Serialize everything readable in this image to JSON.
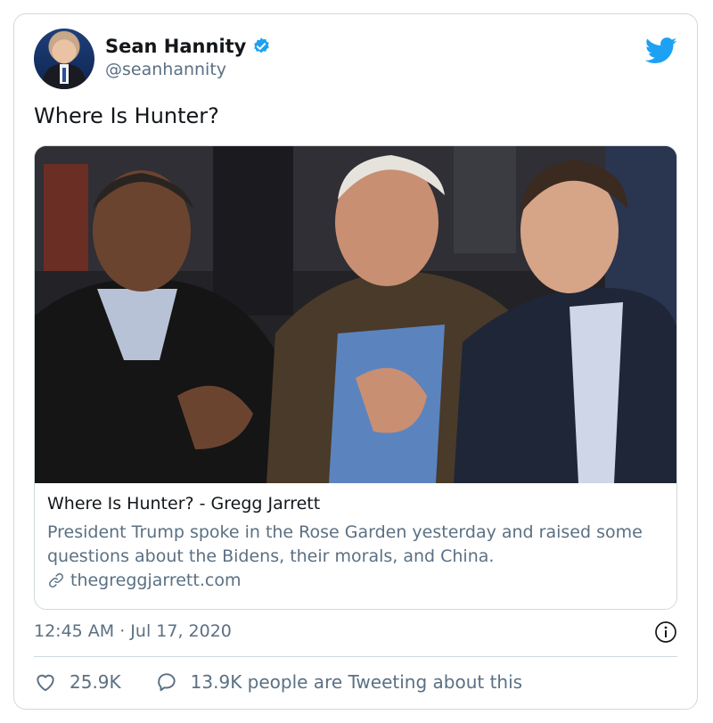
{
  "author": {
    "display_name": "Sean Hannity",
    "handle": "@seanhannity",
    "verified": true
  },
  "tweet": {
    "text": "Where Is Hunter?",
    "timestamp": "12:45 AM · Jul 17, 2020"
  },
  "link_card": {
    "title": "Where Is Hunter? - Gregg Jarrett",
    "description": "President Trump spoke in the Rose Garden yesterday and raised some questions about the Bidens, their morals, and China.",
    "domain": "thegreggjarrett.com",
    "image_icon": "photo-three-men-courtside"
  },
  "engagement": {
    "likes": "25.9K",
    "conversation": "13.9K people are Tweeting about this"
  },
  "icons": {
    "brand": "twitter-bird-icon",
    "verified": "verified-badge-icon",
    "link": "link-icon",
    "info": "info-icon",
    "like": "heart-icon",
    "reply": "speech-bubble-icon"
  },
  "colors": {
    "twitter_blue": "#1da1f2",
    "text_primary": "#14171a",
    "text_secondary": "#5b7083",
    "border": "#cfd9de"
  }
}
